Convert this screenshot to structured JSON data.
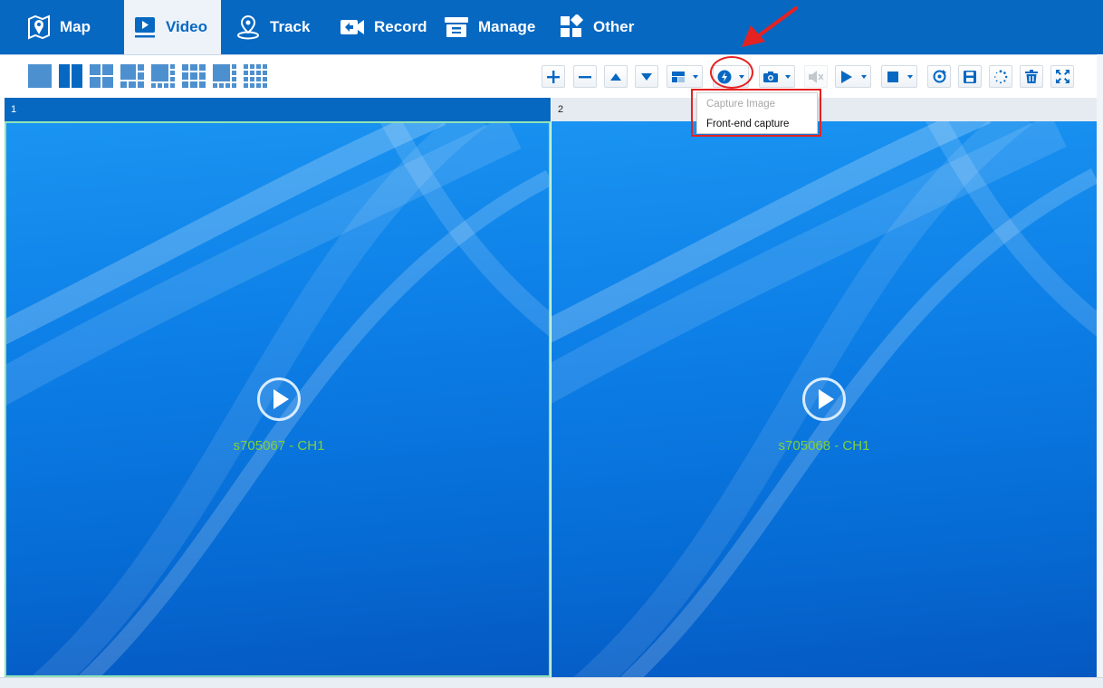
{
  "nav": {
    "items": [
      {
        "label": "Map",
        "icon": "map-pin-icon"
      },
      {
        "label": "Video",
        "icon": "video-play-icon",
        "active": true
      },
      {
        "label": "Track",
        "icon": "location-track-icon"
      },
      {
        "label": "Record",
        "icon": "record-rewind-icon"
      },
      {
        "label": "Manage",
        "icon": "manage-archive-icon"
      },
      {
        "label": "Other",
        "icon": "apps-grid-icon"
      }
    ]
  },
  "toolbar": {
    "layouts": [
      "1-window",
      "2-windows",
      "4-windows",
      "6-windows",
      "8-windows",
      "9-windows",
      "10-windows",
      "16-windows"
    ],
    "buttons": [
      "zoom-in",
      "zoom-out",
      "preset-up",
      "preset-down",
      "layout-mode",
      "capture",
      "snapshot",
      "mute",
      "play-all",
      "stop-all",
      "refresh",
      "save",
      "loading",
      "delete",
      "fullscreen"
    ]
  },
  "capture_menu": {
    "items": [
      {
        "label": "Capture Image",
        "enabled": false
      },
      {
        "label": "Front-end capture",
        "enabled": true
      }
    ]
  },
  "panes": [
    {
      "index": "1",
      "channel": "s705067 - CH1",
      "selected": true
    },
    {
      "index": "2",
      "channel": "s705068 - CH1",
      "selected": false
    }
  ],
  "colors": {
    "primary": "#0768c2",
    "highlight": "#e52222",
    "channel_text": "#7fd13b"
  }
}
